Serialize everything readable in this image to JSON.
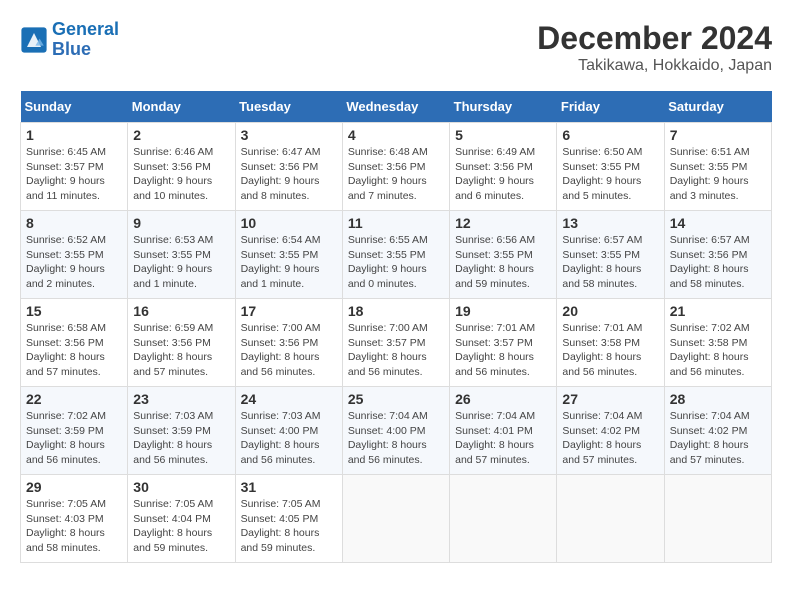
{
  "header": {
    "logo_line1": "General",
    "logo_line2": "Blue",
    "month": "December 2024",
    "location": "Takikawa, Hokkaido, Japan"
  },
  "days_of_week": [
    "Sunday",
    "Monday",
    "Tuesday",
    "Wednesday",
    "Thursday",
    "Friday",
    "Saturday"
  ],
  "weeks": [
    [
      {
        "day": "1",
        "rise": "6:45 AM",
        "set": "3:57 PM",
        "hours": "9 hours and 11 minutes."
      },
      {
        "day": "2",
        "rise": "6:46 AM",
        "set": "3:56 PM",
        "hours": "9 hours and 10 minutes."
      },
      {
        "day": "3",
        "rise": "6:47 AM",
        "set": "3:56 PM",
        "hours": "9 hours and 8 minutes."
      },
      {
        "day": "4",
        "rise": "6:48 AM",
        "set": "3:56 PM",
        "hours": "9 hours and 7 minutes."
      },
      {
        "day": "5",
        "rise": "6:49 AM",
        "set": "3:56 PM",
        "hours": "9 hours and 6 minutes."
      },
      {
        "day": "6",
        "rise": "6:50 AM",
        "set": "3:55 PM",
        "hours": "9 hours and 5 minutes."
      },
      {
        "day": "7",
        "rise": "6:51 AM",
        "set": "3:55 PM",
        "hours": "9 hours and 3 minutes."
      }
    ],
    [
      {
        "day": "8",
        "rise": "6:52 AM",
        "set": "3:55 PM",
        "hours": "9 hours and 2 minutes."
      },
      {
        "day": "9",
        "rise": "6:53 AM",
        "set": "3:55 PM",
        "hours": "9 hours and 1 minute."
      },
      {
        "day": "10",
        "rise": "6:54 AM",
        "set": "3:55 PM",
        "hours": "9 hours and 1 minute."
      },
      {
        "day": "11",
        "rise": "6:55 AM",
        "set": "3:55 PM",
        "hours": "9 hours and 0 minutes."
      },
      {
        "day": "12",
        "rise": "6:56 AM",
        "set": "3:55 PM",
        "hours": "8 hours and 59 minutes."
      },
      {
        "day": "13",
        "rise": "6:57 AM",
        "set": "3:55 PM",
        "hours": "8 hours and 58 minutes."
      },
      {
        "day": "14",
        "rise": "6:57 AM",
        "set": "3:56 PM",
        "hours": "8 hours and 58 minutes."
      }
    ],
    [
      {
        "day": "15",
        "rise": "6:58 AM",
        "set": "3:56 PM",
        "hours": "8 hours and 57 minutes."
      },
      {
        "day": "16",
        "rise": "6:59 AM",
        "set": "3:56 PM",
        "hours": "8 hours and 57 minutes."
      },
      {
        "day": "17",
        "rise": "7:00 AM",
        "set": "3:56 PM",
        "hours": "8 hours and 56 minutes."
      },
      {
        "day": "18",
        "rise": "7:00 AM",
        "set": "3:57 PM",
        "hours": "8 hours and 56 minutes."
      },
      {
        "day": "19",
        "rise": "7:01 AM",
        "set": "3:57 PM",
        "hours": "8 hours and 56 minutes."
      },
      {
        "day": "20",
        "rise": "7:01 AM",
        "set": "3:58 PM",
        "hours": "8 hours and 56 minutes."
      },
      {
        "day": "21",
        "rise": "7:02 AM",
        "set": "3:58 PM",
        "hours": "8 hours and 56 minutes."
      }
    ],
    [
      {
        "day": "22",
        "rise": "7:02 AM",
        "set": "3:59 PM",
        "hours": "8 hours and 56 minutes."
      },
      {
        "day": "23",
        "rise": "7:03 AM",
        "set": "3:59 PM",
        "hours": "8 hours and 56 minutes."
      },
      {
        "day": "24",
        "rise": "7:03 AM",
        "set": "4:00 PM",
        "hours": "8 hours and 56 minutes."
      },
      {
        "day": "25",
        "rise": "7:04 AM",
        "set": "4:00 PM",
        "hours": "8 hours and 56 minutes."
      },
      {
        "day": "26",
        "rise": "7:04 AM",
        "set": "4:01 PM",
        "hours": "8 hours and 57 minutes."
      },
      {
        "day": "27",
        "rise": "7:04 AM",
        "set": "4:02 PM",
        "hours": "8 hours and 57 minutes."
      },
      {
        "day": "28",
        "rise": "7:04 AM",
        "set": "4:02 PM",
        "hours": "8 hours and 57 minutes."
      }
    ],
    [
      {
        "day": "29",
        "rise": "7:05 AM",
        "set": "4:03 PM",
        "hours": "8 hours and 58 minutes."
      },
      {
        "day": "30",
        "rise": "7:05 AM",
        "set": "4:04 PM",
        "hours": "8 hours and 59 minutes."
      },
      {
        "day": "31",
        "rise": "7:05 AM",
        "set": "4:05 PM",
        "hours": "8 hours and 59 minutes."
      },
      null,
      null,
      null,
      null
    ]
  ]
}
